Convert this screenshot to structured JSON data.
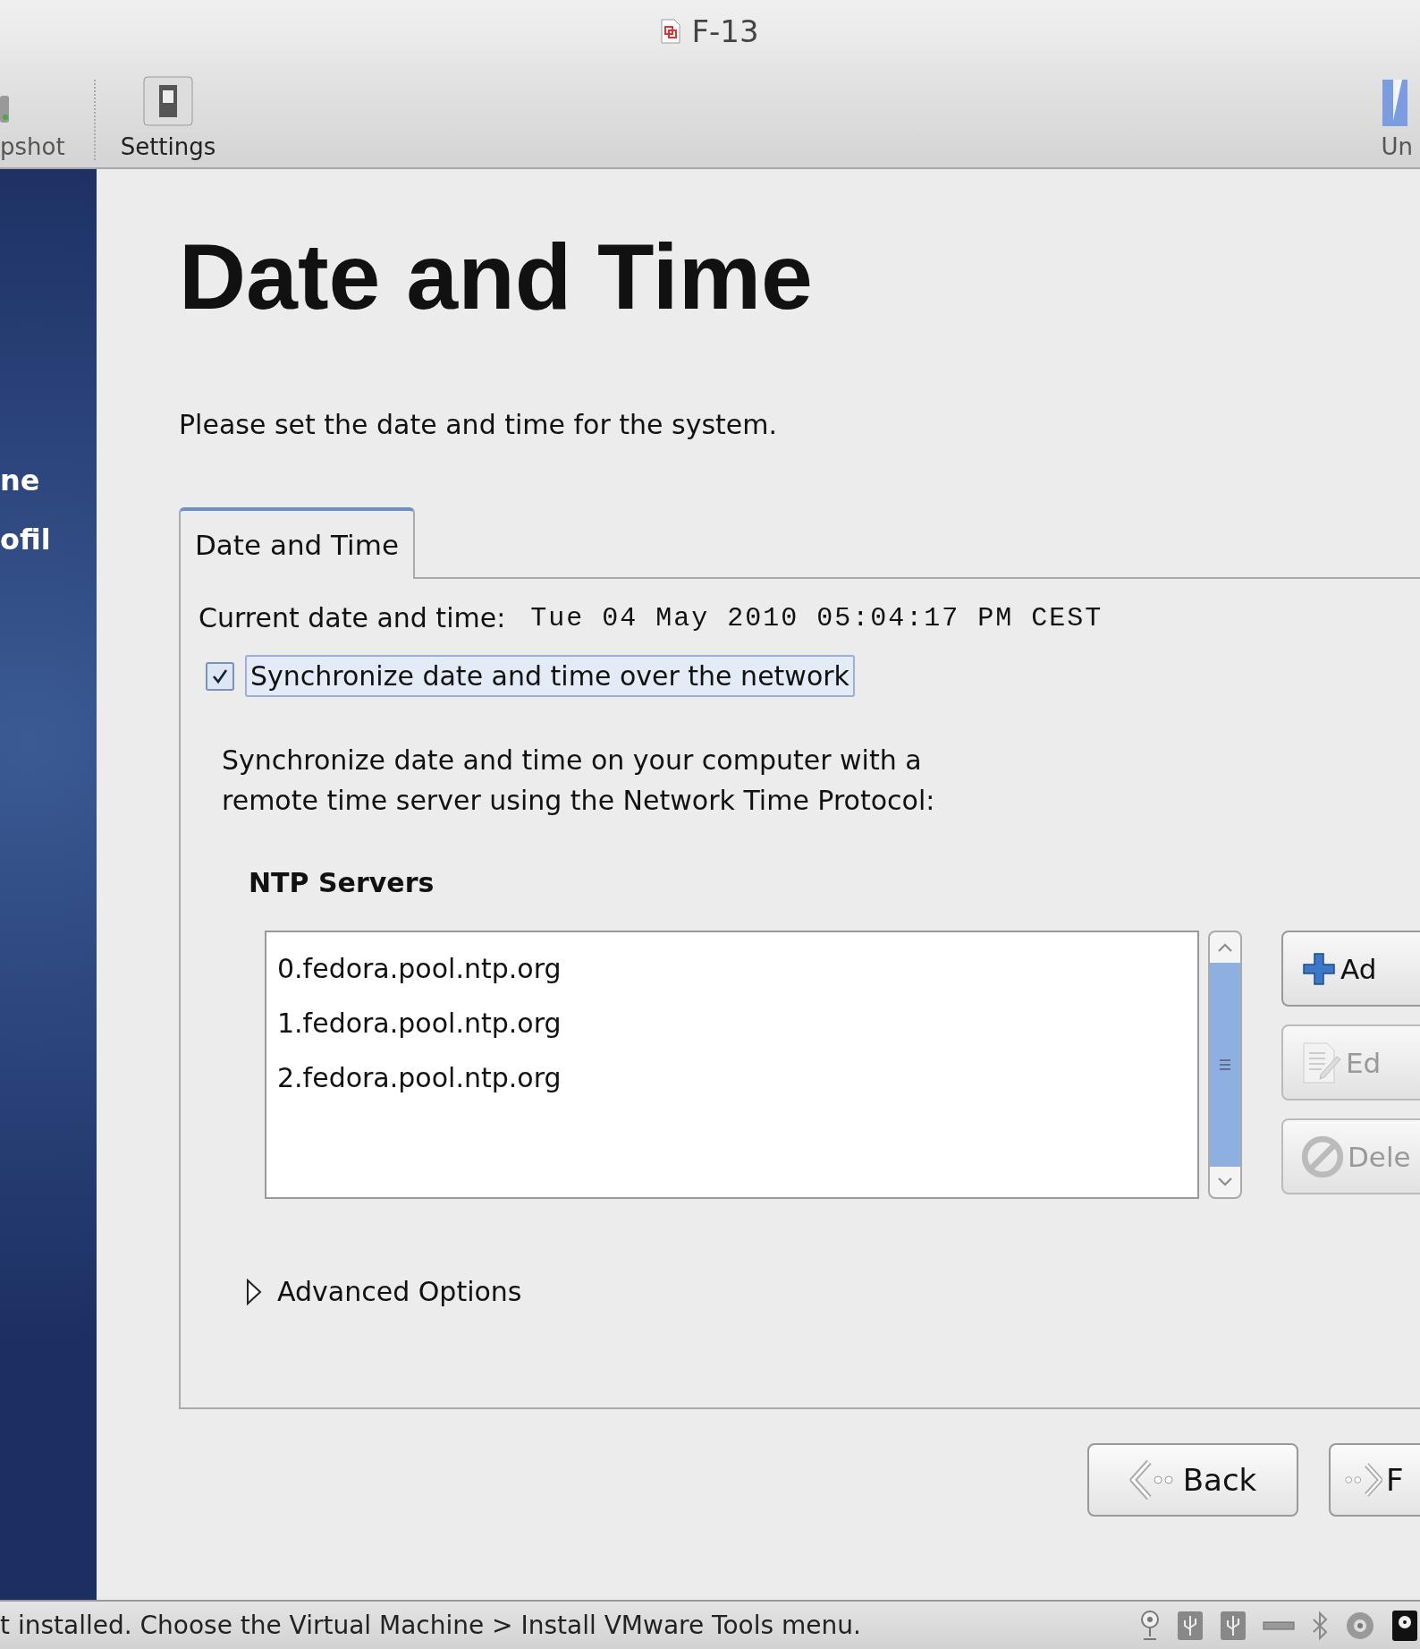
{
  "window": {
    "title": "F-13"
  },
  "toolbar": {
    "items": [
      {
        "label": "pshot",
        "kind": "snapshot"
      },
      {
        "label": "Settings",
        "kind": "settings"
      },
      {
        "label": "Un",
        "kind": "unity"
      }
    ]
  },
  "sidebar": {
    "items": [
      "ne",
      "ofil"
    ]
  },
  "heading": "Date and Time",
  "description": "Please set the date and time for the system.",
  "tabs": [
    {
      "label": "Date and Time",
      "selected": true
    }
  ],
  "current": {
    "label": "Current date and time:",
    "value": "Tue 04 May 2010 05:04:17 PM CEST"
  },
  "sync": {
    "label": "Synchronize date and time over the network",
    "checked": true
  },
  "info": [
    "Synchronize date and time on your computer with a",
    "remote time server using the Network Time Protocol:"
  ],
  "ntp": {
    "title": "NTP Servers",
    "servers": [
      "0.fedora.pool.ntp.org",
      "1.fedora.pool.ntp.org",
      "2.fedora.pool.ntp.org"
    ],
    "buttons": [
      {
        "label": "Ad",
        "kind": "add",
        "disabled": false
      },
      {
        "label": "Ed",
        "kind": "edit",
        "disabled": true
      },
      {
        "label": "Dele",
        "kind": "delete",
        "disabled": true
      }
    ]
  },
  "advanced": {
    "label": "Advanced Options",
    "expanded": false
  },
  "nav_buttons": [
    {
      "label": "Back",
      "kind": "back"
    },
    {
      "label": "F",
      "kind": "forward"
    }
  ],
  "status_bar": {
    "message": "t installed. Choose the Virtual Machine > Install VMware Tools menu."
  }
}
